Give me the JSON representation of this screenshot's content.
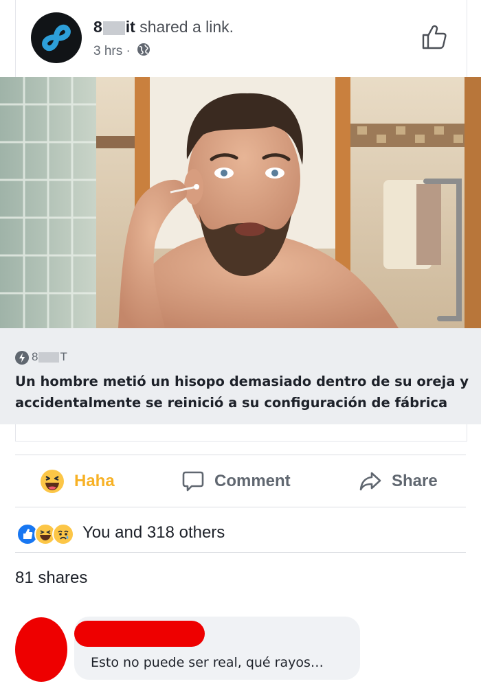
{
  "post": {
    "author_start": "8",
    "author_end": "it",
    "action_text": " shared a link.",
    "time": "3 hrs",
    "separator": "·"
  },
  "link": {
    "source_start": "8",
    "source_end": "T",
    "title": "Un hombre metió un hisopo demasiado dentro de su oreja y accidentalmente se reinició a su configuración de fábrica"
  },
  "actions": {
    "haha_label": "Haha",
    "comment_label": "Comment",
    "share_label": "Share"
  },
  "reactions": {
    "summary": "You and 318 others"
  },
  "shares": {
    "count_text": "81 shares"
  },
  "comment": {
    "text": "Esto no puede ser real, qué rayos…"
  },
  "colors": {
    "haha": "#f7b125",
    "like_blue": "#1877f2",
    "redaction_red": "#ee0000",
    "avatar_logo": "#2d9fd9"
  }
}
